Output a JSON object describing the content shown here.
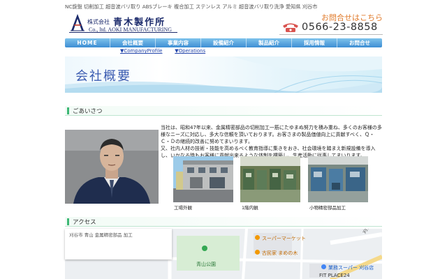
{
  "header": {
    "tagline": "NC旋盤 切削加工 超音波バリ取り ABSブレーキ 複合加工 ステンレス アルミ 超音波バリ取り洗浄 愛知県 刈谷市",
    "company_prefix": "株式会社",
    "company_name": "青木製作所",
    "company_en": "Co., ltd. AOKI MANUFACTURING",
    "contact_title": "お問合せはこちら",
    "phone": "0566-23-8858"
  },
  "nav": {
    "items": [
      "HOME",
      "会社概要",
      "事業内容",
      "設備紹介",
      "製品紹介",
      "採用情報",
      "お問合せ"
    ]
  },
  "sublinks": [
    "▼CompanyProfile",
    "▼Operations"
  ],
  "banner": {
    "title": "会社概要"
  },
  "greeting": {
    "heading": "ごあいさつ",
    "paragraph1": "当社は、昭和47年以来、金属精密部品の切削加工一筋にたゆまぬ努力を積み重ね、多くのお客様の多様なニーズに対応し、多大な信頼を頂いております。お客さまの製品価値向上に貢献すべく、Ｑ・Ｃ・Ｄの継続的改善に努めてまいります。",
    "paragraph2": "又、社内人材の技術・技能を高めるべく教育指導に集きをおき、社会環境を踏まえ新規設備を導入し、いかなる時もお客様に貢献出来るような体制を構築し、生産活動に従事してまいります。",
    "photos": [
      {
        "caption": "工場外観"
      },
      {
        "caption": "1階内観"
      },
      {
        "caption": "小物精密部品加工"
      }
    ]
  },
  "access": {
    "heading": "アクセス",
    "map_labels": {
      "park": "青山公園",
      "supermarket": "スーパーマーケット",
      "restaurant": "古民家 まめの木",
      "store": "業務スーパー 刈谷店",
      "fit_place": "FIT PLACE24",
      "card_text": "刈谷市 青山 金属精密部品 加工",
      "road": "刈谷駅"
    }
  },
  "colors": {
    "nav_top": "#7fc3ec",
    "nav_bottom": "#3d8ed3",
    "accent_green": "#3db874",
    "contact_orange": "#e07a2a",
    "brand_navy": "#1b2a6b",
    "phone_icon": "#d9534f"
  }
}
